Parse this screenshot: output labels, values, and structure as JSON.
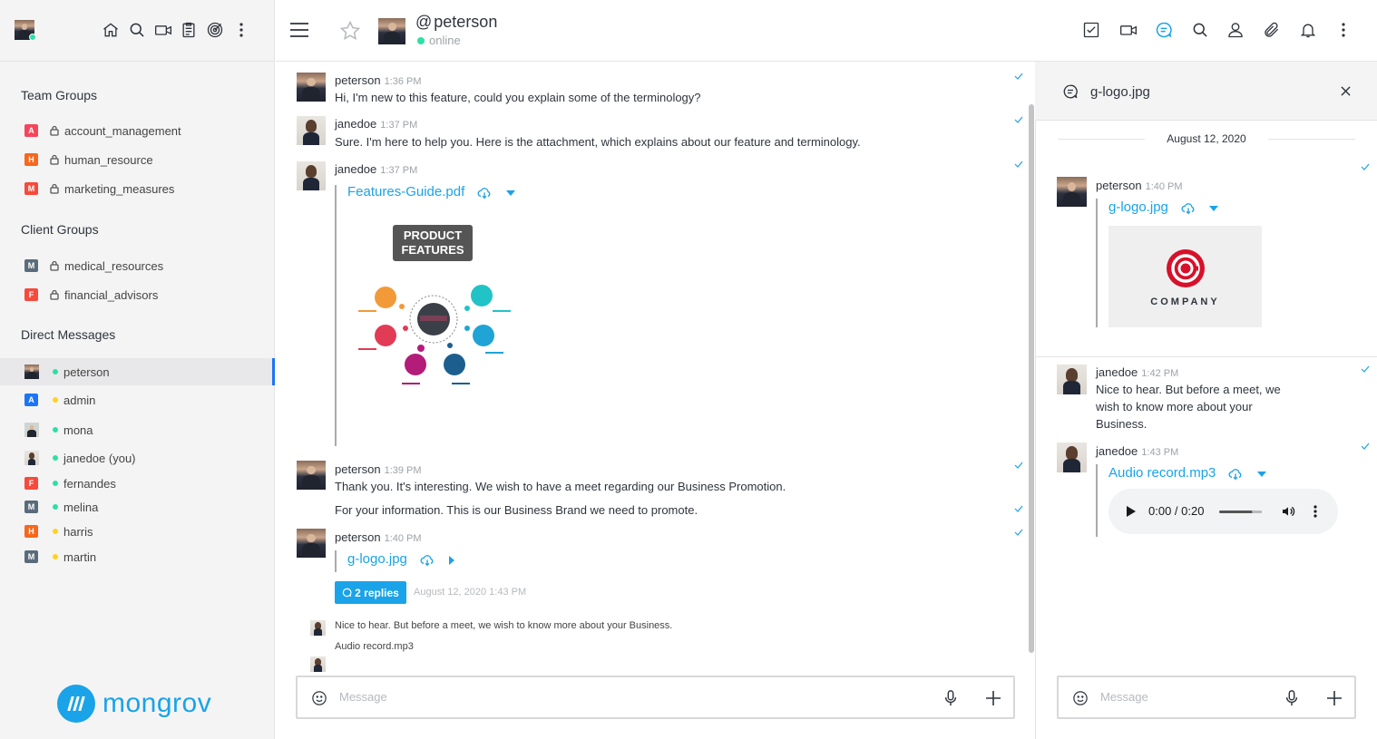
{
  "sidebar": {
    "sections": {
      "team": "Team Groups",
      "client": "Client Groups",
      "direct": "Direct Messages"
    },
    "team_groups": [
      {
        "letter": "A",
        "name": "account_management",
        "color": "#f5455c"
      },
      {
        "letter": "H",
        "name": "human_resource",
        "color": "#f5681d"
      },
      {
        "letter": "M",
        "name": "marketing_measures",
        "color": "#f54a3c"
      }
    ],
    "client_groups": [
      {
        "letter": "M",
        "name": "medical_resources",
        "color": "#5a6b7a"
      },
      {
        "letter": "F",
        "name": "financial_advisors",
        "color": "#f54a3c"
      }
    ],
    "direct_messages": [
      {
        "name": "peterson",
        "status": "online",
        "status_color": "#2de0a5"
      },
      {
        "letter": "A",
        "name": "admin",
        "status": "away",
        "status_color": "#ffd21f",
        "color": "#1d74f5"
      },
      {
        "name": "mona",
        "status": "online",
        "status_color": "#2de0a5"
      },
      {
        "name": "janedoe (you)",
        "status": "online",
        "status_color": "#2de0a5"
      },
      {
        "letter": "F",
        "name": "fernandes",
        "status": "online",
        "status_color": "#2de0a5",
        "color": "#f54a3c"
      },
      {
        "letter": "M",
        "name": "melina",
        "status": "online",
        "status_color": "#2de0a5",
        "color": "#5a6b7a"
      },
      {
        "letter": "H",
        "name": "harris",
        "status": "away",
        "status_color": "#ffd21f",
        "color": "#f5681d"
      },
      {
        "letter": "M",
        "name": "martin",
        "status": "away",
        "status_color": "#ffd21f",
        "color": "#5a6b7a"
      }
    ],
    "logo_text": "mongrov"
  },
  "header": {
    "at": "@",
    "username": "peterson",
    "status": "online"
  },
  "messages": [
    {
      "user": "peterson",
      "time": "1:36 PM",
      "text": "Hi, I'm new to this feature, could you explain some of the terminology?"
    },
    {
      "user": "janedoe",
      "time": "1:37 PM",
      "text": "Sure. I'm here to help you. Here is the attachment, which explains about our feature and terminology."
    },
    {
      "user": "janedoe",
      "time": "1:37 PM",
      "attachment": "Features-Guide.pdf",
      "image_title_1": "PRODUCT",
      "image_title_2": "FEATURES"
    },
    {
      "user": "peterson",
      "time": "1:39 PM",
      "text": "Thank you. It's interesting. We wish to have a meet regarding our Business Promotion.",
      "text2": "For your information. This is our Business Brand we need to promote."
    },
    {
      "user": "peterson",
      "time": "1:40 PM",
      "attachment": "g-logo.jpg",
      "replies": "2 replies",
      "last_reply": "August 12, 2020 1:43 PM"
    }
  ],
  "thread_previews": [
    "Nice to hear. But before a meet, we wish to know more about your Business.",
    "Audio record.mp3"
  ],
  "composer": {
    "placeholder": "Message"
  },
  "thread": {
    "title": "g-logo.jpg",
    "date": "August 12, 2020",
    "messages": [
      {
        "user": "peterson",
        "time": "1:40 PM",
        "attachment": "g-logo.jpg",
        "logo_text": "COMPANY"
      },
      {
        "user": "janedoe",
        "time": "1:42 PM",
        "text_lines": [
          "Nice to hear. But before a meet, we",
          "wish to know more about your",
          "Business."
        ]
      },
      {
        "user": "janedoe",
        "time": "1:43 PM",
        "attachment": "Audio record.mp3",
        "audio_time": "0:00 / 0:20"
      }
    ],
    "composer_placeholder": "Message"
  },
  "colors": {
    "accent": "#1aa3e8",
    "online": "#2de0a5",
    "away": "#ffd21f"
  }
}
